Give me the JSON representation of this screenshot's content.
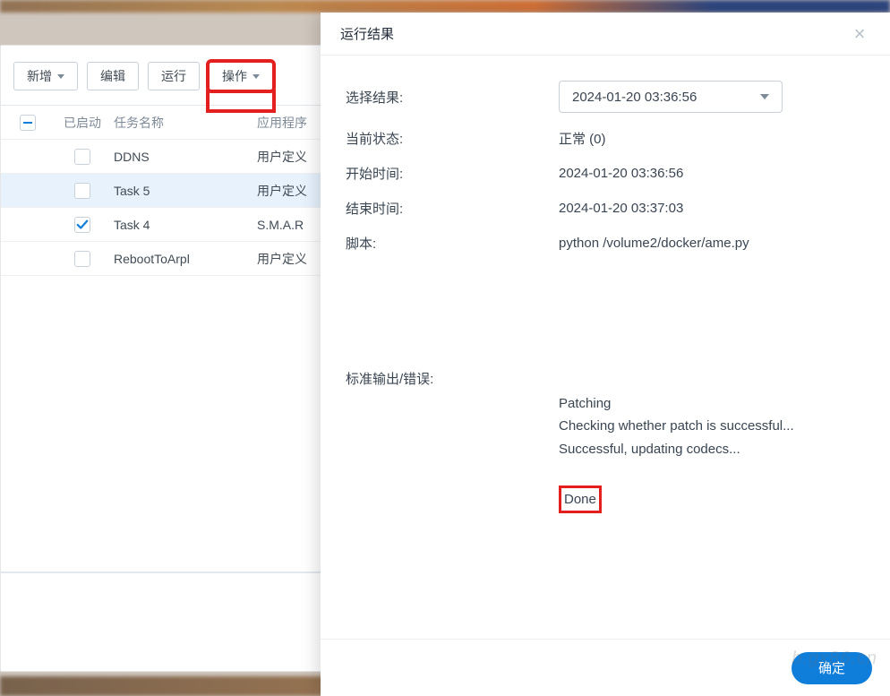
{
  "toolbar": {
    "add": "新增",
    "edit": "编辑",
    "run": "运行",
    "action": "操作"
  },
  "grid": {
    "header_enabled": "已启动",
    "header_name": "任务名称",
    "header_app": "应用程序",
    "rows": [
      {
        "enabled": false,
        "name": "DDNS",
        "app": "用户定义"
      },
      {
        "enabled": false,
        "name": "Task 5",
        "app": "用户定义",
        "selected": true
      },
      {
        "enabled": true,
        "name": "Task 4",
        "app": "S.M.A.R"
      },
      {
        "enabled": false,
        "name": "RebootToArpl",
        "app": "用户定义"
      }
    ]
  },
  "modal": {
    "title": "运行结果",
    "select_result_label": "选择结果:",
    "select_result_value": "2024-01-20 03:36:56",
    "status_label": "当前状态:",
    "status_value": "正常 (0)",
    "start_label": "开始时间:",
    "start_value": "2024-01-20 03:36:56",
    "end_label": "结束时间:",
    "end_value": "2024-01-20 03:37:03",
    "script_label": "脚本:",
    "script_value": "python /volume2/docker/ame.py",
    "stdout_label": "标准输出/错误:",
    "stdout_lines": "Patching\nChecking whether patch is successful...\nSuccessful, updating codecs...",
    "stdout_done": "Done",
    "ok": "确定"
  },
  "watermark": "b.gx86.cn"
}
